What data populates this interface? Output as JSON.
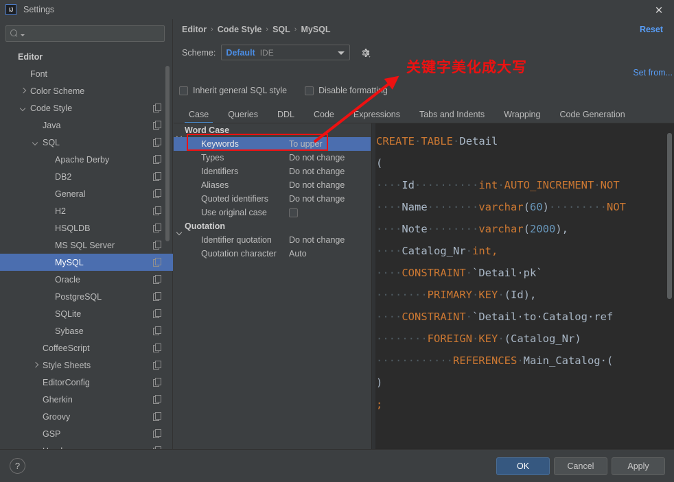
{
  "window": {
    "title": "Settings",
    "logo_text": "IJ",
    "close_icon": "✕"
  },
  "sidebar": {
    "search": {
      "value": "",
      "placeholder": ""
    },
    "items": [
      {
        "label": "Editor",
        "indent": 0,
        "arrow": "none",
        "bold": true,
        "copy": false,
        "selected": false
      },
      {
        "label": "Font",
        "indent": 1,
        "arrow": "none",
        "bold": false,
        "copy": false,
        "selected": false
      },
      {
        "label": "Color Scheme",
        "indent": 1,
        "arrow": "right",
        "bold": false,
        "copy": false,
        "selected": false
      },
      {
        "label": "Code Style",
        "indent": 1,
        "arrow": "down",
        "bold": false,
        "copy": true,
        "selected": false
      },
      {
        "label": "Java",
        "indent": 2,
        "arrow": "none",
        "bold": false,
        "copy": true,
        "selected": false
      },
      {
        "label": "SQL",
        "indent": 2,
        "arrow": "down",
        "bold": false,
        "copy": true,
        "selected": false
      },
      {
        "label": "Apache Derby",
        "indent": 3,
        "arrow": "none",
        "bold": false,
        "copy": true,
        "selected": false
      },
      {
        "label": "DB2",
        "indent": 3,
        "arrow": "none",
        "bold": false,
        "copy": true,
        "selected": false
      },
      {
        "label": "General",
        "indent": 3,
        "arrow": "none",
        "bold": false,
        "copy": true,
        "selected": false
      },
      {
        "label": "H2",
        "indent": 3,
        "arrow": "none",
        "bold": false,
        "copy": true,
        "selected": false
      },
      {
        "label": "HSQLDB",
        "indent": 3,
        "arrow": "none",
        "bold": false,
        "copy": true,
        "selected": false
      },
      {
        "label": "MS SQL Server",
        "indent": 3,
        "arrow": "none",
        "bold": false,
        "copy": true,
        "selected": false
      },
      {
        "label": "MySQL",
        "indent": 3,
        "arrow": "none",
        "bold": false,
        "copy": true,
        "selected": true
      },
      {
        "label": "Oracle",
        "indent": 3,
        "arrow": "none",
        "bold": false,
        "copy": true,
        "selected": false
      },
      {
        "label": "PostgreSQL",
        "indent": 3,
        "arrow": "none",
        "bold": false,
        "copy": true,
        "selected": false
      },
      {
        "label": "SQLite",
        "indent": 3,
        "arrow": "none",
        "bold": false,
        "copy": true,
        "selected": false
      },
      {
        "label": "Sybase",
        "indent": 3,
        "arrow": "none",
        "bold": false,
        "copy": true,
        "selected": false
      },
      {
        "label": "CoffeeScript",
        "indent": 2,
        "arrow": "none",
        "bold": false,
        "copy": true,
        "selected": false
      },
      {
        "label": "Style Sheets",
        "indent": 2,
        "arrow": "right",
        "bold": false,
        "copy": true,
        "selected": false
      },
      {
        "label": "EditorConfig",
        "indent": 2,
        "arrow": "none",
        "bold": false,
        "copy": true,
        "selected": false
      },
      {
        "label": "Gherkin",
        "indent": 2,
        "arrow": "none",
        "bold": false,
        "copy": true,
        "selected": false
      },
      {
        "label": "Groovy",
        "indent": 2,
        "arrow": "none",
        "bold": false,
        "copy": true,
        "selected": false
      },
      {
        "label": "GSP",
        "indent": 2,
        "arrow": "none",
        "bold": false,
        "copy": true,
        "selected": false
      },
      {
        "label": "Haml",
        "indent": 2,
        "arrow": "none",
        "bold": false,
        "copy": true,
        "selected": false
      }
    ]
  },
  "header": {
    "breadcrumb": [
      "Editor",
      "Code Style",
      "SQL",
      "MySQL"
    ],
    "breadcrumb_separator": "›",
    "reset_label": "Reset",
    "set_from_label": "Set from...",
    "scheme_label": "Scheme:",
    "scheme_value": "Default",
    "scheme_suffix": "IDE",
    "gear_icon": "gear-icon"
  },
  "options": {
    "inherit": {
      "label": "Inherit general SQL style",
      "checked": false
    },
    "disable": {
      "label": "Disable formatting",
      "checked": false
    }
  },
  "tabs": [
    {
      "label": "Case",
      "active": true
    },
    {
      "label": "Queries",
      "active": false
    },
    {
      "label": "DDL",
      "active": false
    },
    {
      "label": "Code",
      "active": false
    },
    {
      "label": "Expressions",
      "active": false
    },
    {
      "label": "Tabs and Indents",
      "active": false
    },
    {
      "label": "Wrapping",
      "active": false
    },
    {
      "label": "Code Generation",
      "active": false
    }
  ],
  "settings_rows": [
    {
      "name": "Word Case",
      "value": "",
      "type": "group",
      "selected": false
    },
    {
      "name": "Keywords",
      "value": "To upper",
      "type": "item",
      "selected": true
    },
    {
      "name": "Types",
      "value": "Do not change",
      "type": "item",
      "selected": false
    },
    {
      "name": "Identifiers",
      "value": "Do not change",
      "type": "item",
      "selected": false
    },
    {
      "name": "Aliases",
      "value": "Do not change",
      "type": "item",
      "selected": false
    },
    {
      "name": "Quoted identifiers",
      "value": "Do not change",
      "type": "item",
      "selected": false
    },
    {
      "name": "Use original case",
      "value": "",
      "type": "checkbox",
      "checked": false,
      "selected": false
    },
    {
      "name": "Quotation",
      "value": "",
      "type": "group",
      "selected": false
    },
    {
      "name": "Identifier quotation",
      "value": "Do not change",
      "type": "item",
      "selected": false
    },
    {
      "name": "Quotation character",
      "value": "Auto",
      "type": "item",
      "selected": false
    }
  ],
  "preview": {
    "lines": [
      [
        {
          "t": "CREATE",
          "c": "kw"
        },
        {
          "t": "·",
          "c": "dot"
        },
        {
          "t": "TABLE",
          "c": "kw"
        },
        {
          "t": "·",
          "c": "dot"
        },
        {
          "t": "Detail",
          "c": "id"
        }
      ],
      [
        {
          "t": "(",
          "c": "id"
        }
      ],
      [
        {
          "t": "····",
          "c": "dot"
        },
        {
          "t": "Id",
          "c": "id"
        },
        {
          "t": "··········",
          "c": "dot"
        },
        {
          "t": "int",
          "c": "kw"
        },
        {
          "t": "·",
          "c": "dot"
        },
        {
          "t": "AUTO_INCREMENT",
          "c": "kw"
        },
        {
          "t": "·",
          "c": "dot"
        },
        {
          "t": "NOT",
          "c": "kw"
        }
      ],
      [
        {
          "t": "····",
          "c": "dot"
        },
        {
          "t": "Name",
          "c": "id"
        },
        {
          "t": "········",
          "c": "dot"
        },
        {
          "t": "varchar",
          "c": "kw"
        },
        {
          "t": "(",
          "c": "id"
        },
        {
          "t": "60",
          "c": "num"
        },
        {
          "t": ")",
          "c": "id"
        },
        {
          "t": "·········",
          "c": "dot"
        },
        {
          "t": "NOT",
          "c": "kw"
        }
      ],
      [
        {
          "t": "····",
          "c": "dot"
        },
        {
          "t": "Note",
          "c": "id"
        },
        {
          "t": "········",
          "c": "dot"
        },
        {
          "t": "varchar",
          "c": "kw"
        },
        {
          "t": "(",
          "c": "id"
        },
        {
          "t": "2000",
          "c": "num"
        },
        {
          "t": "),",
          "c": "id"
        }
      ],
      [
        {
          "t": "····",
          "c": "dot"
        },
        {
          "t": "Catalog_Nr",
          "c": "id"
        },
        {
          "t": "·",
          "c": "dot"
        },
        {
          "t": "int,",
          "c": "kw"
        }
      ],
      [
        {
          "t": "····",
          "c": "dot"
        },
        {
          "t": "CONSTRAINT",
          "c": "kw"
        },
        {
          "t": "·",
          "c": "dot"
        },
        {
          "t": "`Detail·pk`",
          "c": "id"
        }
      ],
      [
        {
          "t": "········",
          "c": "dot"
        },
        {
          "t": "PRIMARY",
          "c": "kw"
        },
        {
          "t": "·",
          "c": "dot"
        },
        {
          "t": "KEY",
          "c": "kw"
        },
        {
          "t": "·",
          "c": "dot"
        },
        {
          "t": "(Id),",
          "c": "id"
        }
      ],
      [
        {
          "t": "····",
          "c": "dot"
        },
        {
          "t": "CONSTRAINT",
          "c": "kw"
        },
        {
          "t": "·",
          "c": "dot"
        },
        {
          "t": "`Detail·to·Catalog·ref",
          "c": "id"
        }
      ],
      [
        {
          "t": "········",
          "c": "dot"
        },
        {
          "t": "FOREIGN",
          "c": "kw"
        },
        {
          "t": "·",
          "c": "dot"
        },
        {
          "t": "KEY",
          "c": "kw"
        },
        {
          "t": "·",
          "c": "dot"
        },
        {
          "t": "(Catalog_Nr)",
          "c": "id"
        }
      ],
      [
        {
          "t": "············",
          "c": "dot"
        },
        {
          "t": "REFERENCES",
          "c": "kw"
        },
        {
          "t": "·",
          "c": "dot"
        },
        {
          "t": "Main_Catalog·(",
          "c": "id"
        }
      ],
      [
        {
          "t": ")",
          "c": "id"
        }
      ],
      [
        {
          "t": ";",
          "c": "kw"
        }
      ]
    ]
  },
  "annotation": {
    "text": "关键字美化成大写",
    "color": "#ee1111"
  },
  "footer": {
    "help_label": "?",
    "ok_label": "OK",
    "cancel_label": "Cancel",
    "apply_label": "Apply"
  },
  "colors": {
    "accent_blue": "#4b6eaf",
    "link_blue": "#589df6",
    "keyword_orange": "#cc7832",
    "number_blue": "#6897bb",
    "annotation_red": "#ee1111",
    "bg": "#3c3f41",
    "editor_bg": "#2b2b2b"
  }
}
